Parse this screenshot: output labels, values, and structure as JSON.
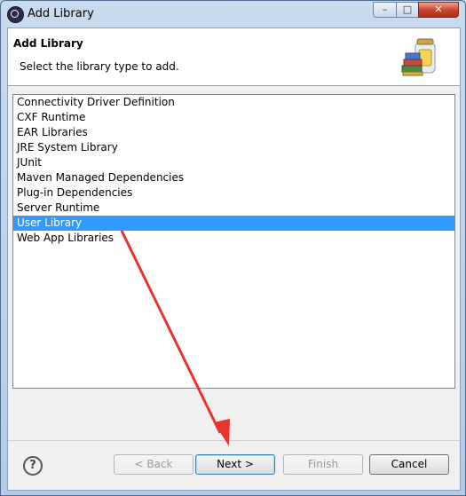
{
  "window": {
    "title": "Add Library",
    "minimize_label": "–",
    "maximize_label": "□",
    "close_label": "✕"
  },
  "header": {
    "title": "Add Library",
    "description": "Select the library type to add."
  },
  "list": {
    "items": [
      "Connectivity Driver Definition",
      "CXF Runtime",
      "EAR Libraries",
      "JRE System Library",
      "JUnit",
      "Maven Managed Dependencies",
      "Plug-in Dependencies",
      "Server Runtime",
      "User Library",
      "Web App Libraries"
    ],
    "selected": "User Library"
  },
  "footer": {
    "help_label": "?",
    "back_label": "< Back",
    "next_label": "Next >",
    "finish_label": "Finish",
    "cancel_label": "Cancel"
  },
  "colors": {
    "selection": "#3399ff",
    "annotation_arrow": "#e8342c"
  },
  "icons": {
    "app": "eclipse-icon",
    "header": "library-jar-icon",
    "help": "help-icon"
  }
}
